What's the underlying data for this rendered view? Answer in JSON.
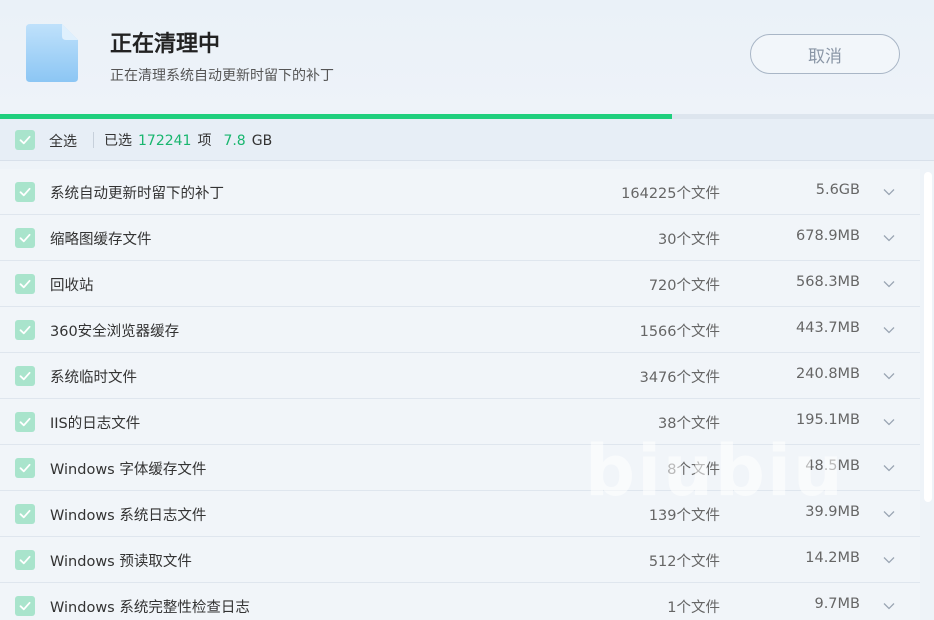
{
  "header": {
    "title": "正在清理中",
    "subtitle": "正在清理系统自动更新时留下的补丁",
    "cancel_label": "取消"
  },
  "progress": {
    "fraction": 0.72,
    "color": "#1fcf7e"
  },
  "selection": {
    "select_all_label": "全选",
    "prefix": "已选",
    "count": "172241",
    "count_unit": "项",
    "size": "7.8",
    "size_unit": "GB",
    "accent": "#19b66f"
  },
  "items": [
    {
      "name": "系统自动更新时留下的补丁",
      "count": "164225个文件",
      "size": "5.6GB"
    },
    {
      "name": "缩略图缓存文件",
      "count": "30个文件",
      "size": "678.9MB"
    },
    {
      "name": "回收站",
      "count": "720个文件",
      "size": "568.3MB"
    },
    {
      "name": "360安全浏览器缓存",
      "count": "1566个文件",
      "size": "443.7MB"
    },
    {
      "name": "系统临时文件",
      "count": "3476个文件",
      "size": "240.8MB"
    },
    {
      "name": "IIS的日志文件",
      "count": "38个文件",
      "size": "195.1MB"
    },
    {
      "name": "Windows 字体缓存文件",
      "count": "8个文件",
      "size": "48.5MB"
    },
    {
      "name": "Windows 系统日志文件",
      "count": "139个文件",
      "size": "39.9MB"
    },
    {
      "name": "Windows 预读取文件",
      "count": "512个文件",
      "size": "14.2MB"
    },
    {
      "name": "Windows 系统完整性检查日志",
      "count": "1个文件",
      "size": "9.7MB"
    }
  ],
  "watermark": "biubiu",
  "icons": {
    "file": "file-icon",
    "check": "check-icon",
    "expand": "chevron-down-icon"
  }
}
